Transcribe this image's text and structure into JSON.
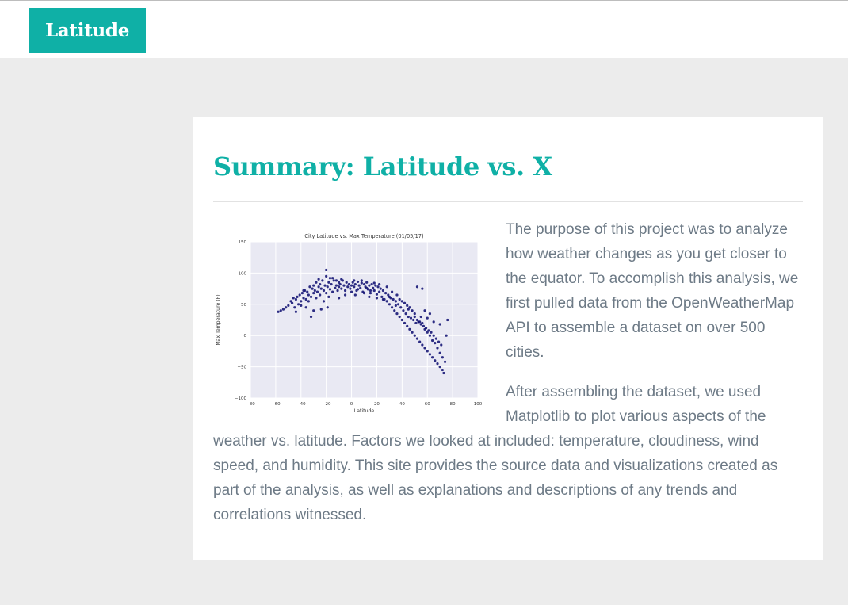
{
  "nav": {
    "brand": "Latitude"
  },
  "main": {
    "title": "Summary: Latitude vs. X",
    "paragraphs": [
      "The purpose of this project was to analyze how weather changes as you get closer to the equator. To accomplish this analysis, we first pulled data from the OpenWeatherMap API to assemble a dataset on over 500 cities.",
      "After assembling the dataset, we used Matplotlib to plot various aspects of the weather vs. latitude. Factors we looked at included: temperature, cloudiness, wind speed, and humidity. This site provides the source data and visualizations created as part of the analysis, as well as explanations and descriptions of any trends and correlations witnessed."
    ]
  },
  "colors": {
    "accent": "#0fb0a6",
    "text": "#6d7a86",
    "point": "#0b0b6e",
    "plot_bg": "#e9e9f3"
  },
  "chart_data": {
    "type": "scatter",
    "title": "City Latitude vs. Max Temperature (01/05/17)",
    "xlabel": "Latitude",
    "ylabel": "Max Temperature (F)",
    "xlim": [
      -80,
      100
    ],
    "ylim": [
      -100,
      150
    ],
    "xticks": [
      -80,
      -60,
      -40,
      -20,
      0,
      20,
      40,
      60,
      80,
      100
    ],
    "yticks": [
      -100,
      -50,
      0,
      50,
      100,
      150
    ],
    "grid": true,
    "series": [
      {
        "points": [
          [
            -56,
            40
          ],
          [
            -54,
            42
          ],
          [
            -52,
            45
          ],
          [
            -50,
            48
          ],
          [
            -48,
            55
          ],
          [
            -47,
            52
          ],
          [
            -46,
            60
          ],
          [
            -45,
            45
          ],
          [
            -44,
            58
          ],
          [
            -43,
            62
          ],
          [
            -42,
            50
          ],
          [
            -41,
            65
          ],
          [
            -40,
            55
          ],
          [
            -39,
            68
          ],
          [
            -38,
            60
          ],
          [
            -37,
            72
          ],
          [
            -36,
            58
          ],
          [
            -35,
            70
          ],
          [
            -34,
            65
          ],
          [
            -33,
            78
          ],
          [
            -32,
            62
          ],
          [
            -31,
            75
          ],
          [
            -30,
            68
          ],
          [
            -30,
            80
          ],
          [
            -29,
            72
          ],
          [
            -28,
            85
          ],
          [
            -27,
            70
          ],
          [
            -26,
            78
          ],
          [
            -25,
            65
          ],
          [
            -25,
            82
          ],
          [
            -24,
            75
          ],
          [
            -23,
            88
          ],
          [
            -22,
            72
          ],
          [
            -21,
            80
          ],
          [
            -20,
            95
          ],
          [
            -20,
            68
          ],
          [
            -19,
            78
          ],
          [
            -18,
            85
          ],
          [
            -17,
            74
          ],
          [
            -16,
            82
          ],
          [
            -15,
            70
          ],
          [
            -14,
            88
          ],
          [
            -13,
            76
          ],
          [
            -12,
            80
          ],
          [
            -11,
            72
          ],
          [
            -10,
            85
          ],
          [
            -10,
            78
          ],
          [
            -9,
            82
          ],
          [
            -8,
            75
          ],
          [
            -7,
            88
          ],
          [
            -6,
            80
          ],
          [
            -5,
            72
          ],
          [
            -4,
            85
          ],
          [
            -3,
            78
          ],
          [
            -2,
            82
          ],
          [
            -1,
            75
          ],
          [
            0,
            80
          ],
          [
            1,
            85
          ],
          [
            2,
            78
          ],
          [
            3,
            82
          ],
          [
            4,
            72
          ],
          [
            5,
            86
          ],
          [
            6,
            80
          ],
          [
            7,
            76
          ],
          [
            8,
            84
          ],
          [
            9,
            70
          ],
          [
            10,
            82
          ],
          [
            11,
            78
          ],
          [
            12,
            85
          ],
          [
            13,
            74
          ],
          [
            14,
            80
          ],
          [
            15,
            68
          ],
          [
            16,
            82
          ],
          [
            17,
            76
          ],
          [
            18,
            72
          ],
          [
            19,
            80
          ],
          [
            20,
            66
          ],
          [
            21,
            78
          ],
          [
            22,
            70
          ],
          [
            23,
            75
          ],
          [
            24,
            62
          ],
          [
            25,
            72
          ],
          [
            26,
            58
          ],
          [
            27,
            68
          ],
          [
            28,
            55
          ],
          [
            29,
            65
          ],
          [
            30,
            50
          ],
          [
            31,
            60
          ],
          [
            32,
            45
          ],
          [
            33,
            58
          ],
          [
            34,
            40
          ],
          [
            35,
            55
          ],
          [
            36,
            35
          ],
          [
            37,
            50
          ],
          [
            38,
            30
          ],
          [
            39,
            45
          ],
          [
            40,
            25
          ],
          [
            41,
            40
          ],
          [
            42,
            20
          ],
          [
            43,
            35
          ],
          [
            44,
            15
          ],
          [
            45,
            30
          ],
          [
            46,
            10
          ],
          [
            47,
            28
          ],
          [
            48,
            5
          ],
          [
            49,
            25
          ],
          [
            50,
            0
          ],
          [
            51,
            20
          ],
          [
            52,
            -5
          ],
          [
            53,
            22
          ],
          [
            54,
            -10
          ],
          [
            55,
            18
          ],
          [
            56,
            -15
          ],
          [
            57,
            15
          ],
          [
            58,
            -20
          ],
          [
            59,
            12
          ],
          [
            60,
            -25
          ],
          [
            61,
            8
          ],
          [
            62,
            -30
          ],
          [
            63,
            5
          ],
          [
            64,
            -35
          ],
          [
            65,
            0
          ],
          [
            66,
            -40
          ],
          [
            67,
            -5
          ],
          [
            68,
            -45
          ],
          [
            69,
            -10
          ],
          [
            70,
            -50
          ],
          [
            71,
            -15
          ],
          [
            72,
            -55
          ],
          [
            73,
            -60
          ],
          [
            -58,
            38
          ],
          [
            -36,
            45
          ],
          [
            -34,
            55
          ],
          [
            -28,
            60
          ],
          [
            -24,
            42
          ],
          [
            -22,
            55
          ],
          [
            -18,
            62
          ],
          [
            -15,
            92
          ],
          [
            -30,
            40
          ],
          [
            -12,
            88
          ],
          [
            -5,
            65
          ],
          [
            0,
            70
          ],
          [
            5,
            74
          ],
          [
            10,
            68
          ],
          [
            15,
            72
          ],
          [
            20,
            60
          ],
          [
            25,
            58
          ],
          [
            30,
            62
          ],
          [
            35,
            48
          ],
          [
            40,
            55
          ],
          [
            45,
            42
          ],
          [
            50,
            35
          ],
          [
            55,
            30
          ],
          [
            60,
            28
          ],
          [
            65,
            22
          ],
          [
            70,
            18
          ],
          [
            52,
            78
          ],
          [
            56,
            75
          ],
          [
            58,
            40
          ],
          [
            62,
            35
          ],
          [
            -44,
            38
          ],
          [
            -40,
            48
          ],
          [
            -38,
            72
          ],
          [
            -26,
            90
          ],
          [
            -20,
            105
          ],
          [
            -17,
            92
          ],
          [
            -8,
            90
          ],
          [
            2,
            88
          ],
          [
            8,
            88
          ],
          [
            12,
            76
          ],
          [
            18,
            84
          ],
          [
            22,
            82
          ],
          [
            28,
            78
          ],
          [
            32,
            70
          ],
          [
            36,
            65
          ],
          [
            38,
            58
          ],
          [
            42,
            52
          ],
          [
            44,
            48
          ],
          [
            46,
            45
          ],
          [
            48,
            40
          ],
          [
            50,
            30
          ],
          [
            52,
            25
          ],
          [
            54,
            22
          ],
          [
            56,
            20
          ],
          [
            58,
            10
          ],
          [
            60,
            5
          ],
          [
            62,
            0
          ],
          [
            64,
            -8
          ],
          [
            66,
            -12
          ],
          [
            68,
            -20
          ],
          [
            70,
            -28
          ],
          [
            72,
            -35
          ],
          [
            74,
            -42
          ],
          [
            75,
            0
          ],
          [
            76,
            25
          ],
          [
            -32,
            30
          ],
          [
            -19,
            45
          ],
          [
            -10,
            60
          ],
          [
            3,
            65
          ],
          [
            14,
            62
          ]
        ]
      }
    ]
  }
}
